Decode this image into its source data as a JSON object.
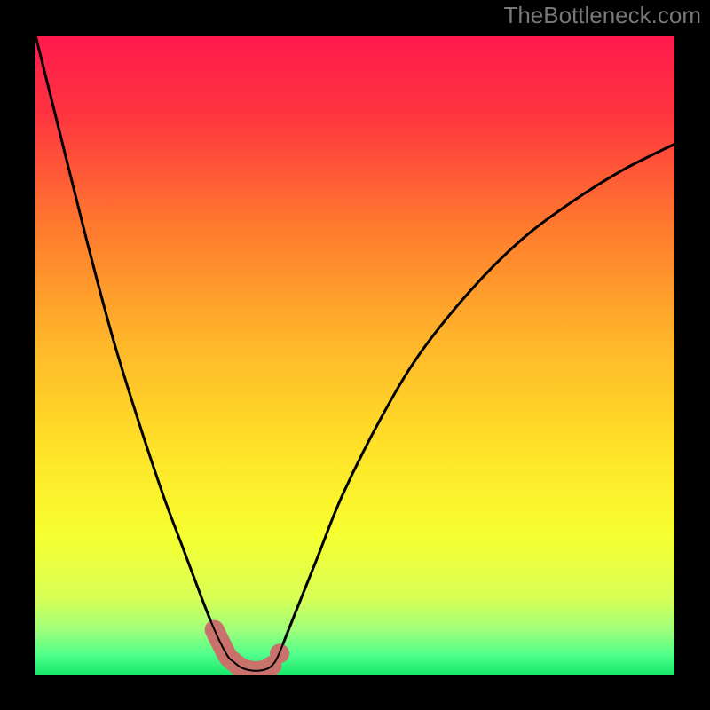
{
  "watermark": "TheBottleneck.com",
  "chart_data": {
    "type": "line",
    "title": "",
    "xlabel": "",
    "ylabel": "",
    "xlim": [
      0,
      100
    ],
    "ylim": [
      0,
      100
    ],
    "series": [
      {
        "name": "curve",
        "x": [
          0,
          4,
          8,
          12,
          16,
          20,
          23,
          26,
          28,
          30,
          31,
          32,
          33,
          34,
          35,
          36,
          37,
          38,
          40,
          44,
          48,
          54,
          60,
          68,
          76,
          84,
          92,
          100
        ],
        "values": [
          100,
          84,
          68,
          53,
          40,
          28,
          20,
          12,
          7,
          3,
          2,
          1.2,
          0.8,
          0.6,
          0.6,
          0.8,
          1.4,
          3,
          8,
          18,
          28,
          40,
          50,
          60,
          68,
          74,
          79,
          83
        ]
      },
      {
        "name": "highlight",
        "x": [
          28,
          30,
          31,
          32,
          33,
          34,
          35,
          36,
          37
        ],
        "values": [
          7,
          3,
          2,
          1.2,
          0.8,
          0.6,
          0.6,
          0.8,
          1.4
        ]
      }
    ],
    "gradient_stops": [
      {
        "offset": 0.0,
        "color": "#ff1a4d"
      },
      {
        "offset": 0.12,
        "color": "#ff3340"
      },
      {
        "offset": 0.3,
        "color": "#ff7a2e"
      },
      {
        "offset": 0.48,
        "color": "#ffb62a"
      },
      {
        "offset": 0.64,
        "color": "#ffe027"
      },
      {
        "offset": 0.78,
        "color": "#f7ff30"
      },
      {
        "offset": 0.88,
        "color": "#d8ff55"
      },
      {
        "offset": 0.93,
        "color": "#9fff7a"
      },
      {
        "offset": 0.97,
        "color": "#4dff8a"
      },
      {
        "offset": 1.0,
        "color": "#17e86b"
      }
    ],
    "curve_color": "#000000",
    "highlight_color": "#c9716b"
  }
}
